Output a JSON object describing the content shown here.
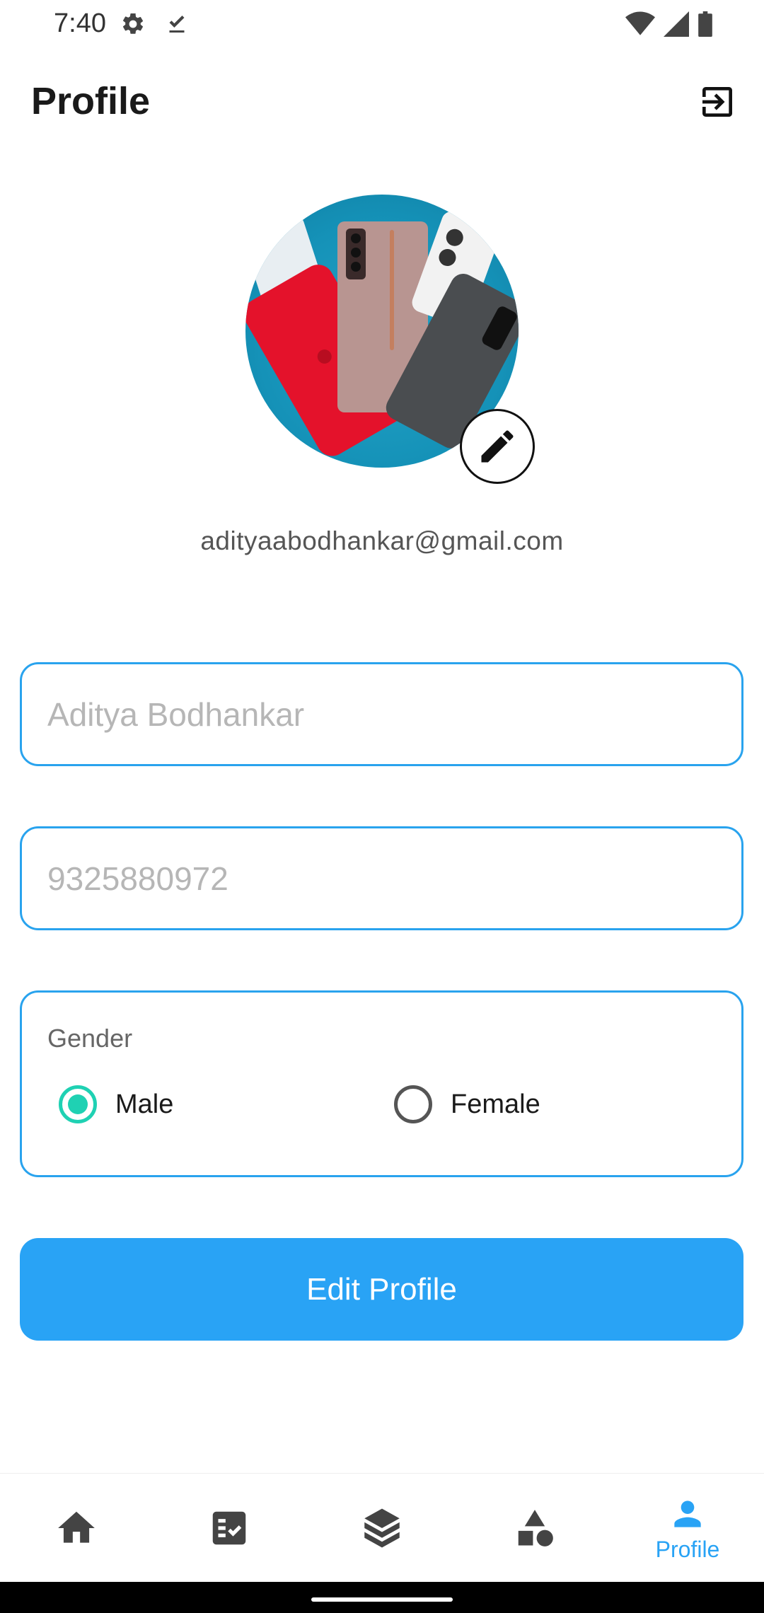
{
  "status_bar": {
    "time": "7:40",
    "icons": [
      "gear-icon",
      "download-done-icon",
      "wifi-icon",
      "signal-icon",
      "battery-icon"
    ]
  },
  "header": {
    "title": "Profile",
    "logout_icon": "logout-icon"
  },
  "profile": {
    "email": "adityaabodhankar@gmail.com",
    "edit_avatar_icon": "pencil-icon"
  },
  "form": {
    "name_placeholder": "Aditya Bodhankar",
    "phone_placeholder": "9325880972",
    "gender": {
      "label": "Gender",
      "options": [
        {
          "label": "Male",
          "selected": true
        },
        {
          "label": "Female",
          "selected": false
        }
      ]
    },
    "submit_label": "Edit Profile"
  },
  "bottom_nav": {
    "items": [
      {
        "icon": "home-icon",
        "label": "",
        "active": false
      },
      {
        "icon": "checklist-icon",
        "label": "",
        "active": false
      },
      {
        "icon": "box-icon",
        "label": "",
        "active": false
      },
      {
        "icon": "shapes-icon",
        "label": "",
        "active": false
      },
      {
        "icon": "person-icon",
        "label": "Profile",
        "active": true
      }
    ]
  },
  "colors": {
    "accent": "#29a3f5",
    "radio_selected": "#1fd1b3",
    "nav_inactive": "#444444"
  }
}
